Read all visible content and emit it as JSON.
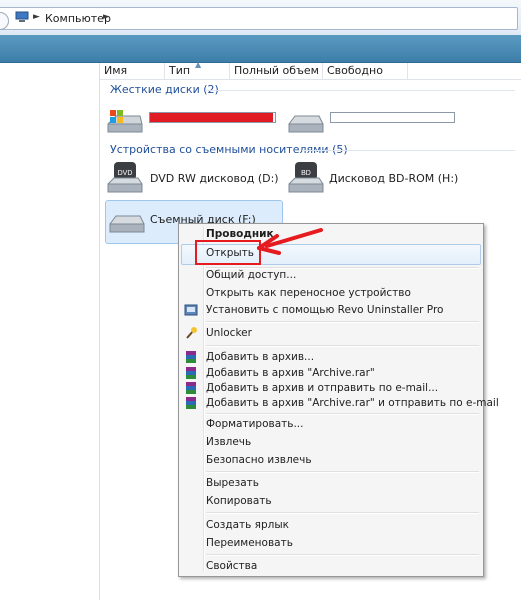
{
  "address": {
    "crumb": "Компьютер",
    "separator": "►"
  },
  "columns": [
    "Имя",
    "Тип",
    "Полный объем",
    "Свободно"
  ],
  "groups": {
    "hard": {
      "title": "Жесткие диски (2)"
    },
    "removable": {
      "title": "Устройства со съемными носителями (5)",
      "items": [
        {
          "label": "DVD RW дисковод (D:)",
          "badge": "DVD"
        },
        {
          "label": "Дисковод BD-ROM (H:)",
          "badge": "BD"
        },
        {
          "label": "Съемный диск (F:)"
        }
      ]
    }
  },
  "drive_usage": [
    {
      "name": "drive-c",
      "fraction": 0.98,
      "color": "#e01b24"
    },
    {
      "name": "drive-e",
      "fraction": 0.0,
      "color": "#3a8fe0"
    }
  ],
  "menu": {
    "items": [
      {
        "label": "Проводник",
        "bold": true
      },
      {
        "label": "Открыть"
      },
      {
        "label": "Общий доступ..."
      },
      {
        "label": "Открыть как переносное устройство"
      },
      {
        "label": "Установить с помощью Revo Uninstaller Pro",
        "icon": "revo-uninstaller-icon"
      },
      {
        "label": "Unlocker",
        "icon": "unlocker-wand-icon"
      },
      {
        "label": "Добавить в архив...",
        "icon": "winrar-icon"
      },
      {
        "label": "Добавить в архив \"Archive.rar\"",
        "icon": "winrar-icon"
      },
      {
        "label": "Добавить в архив и отправить по e-mail...",
        "icon": "winrar-icon"
      },
      {
        "label": "Добавить в архив \"Archive.rar\" и отправить по e-mail",
        "icon": "winrar-icon"
      },
      {
        "label": "Форматировать..."
      },
      {
        "label": "Извлечь"
      },
      {
        "label": "Безопасно извлечь"
      },
      {
        "label": "Вырезать"
      },
      {
        "label": "Копировать"
      },
      {
        "label": "Создать ярлык"
      },
      {
        "label": "Переименовать"
      },
      {
        "label": "Свойства"
      }
    ]
  },
  "colors": {
    "accent": "#1f4f9a",
    "highlight": "#e51b20",
    "toolbar": "#3d7ea9"
  }
}
